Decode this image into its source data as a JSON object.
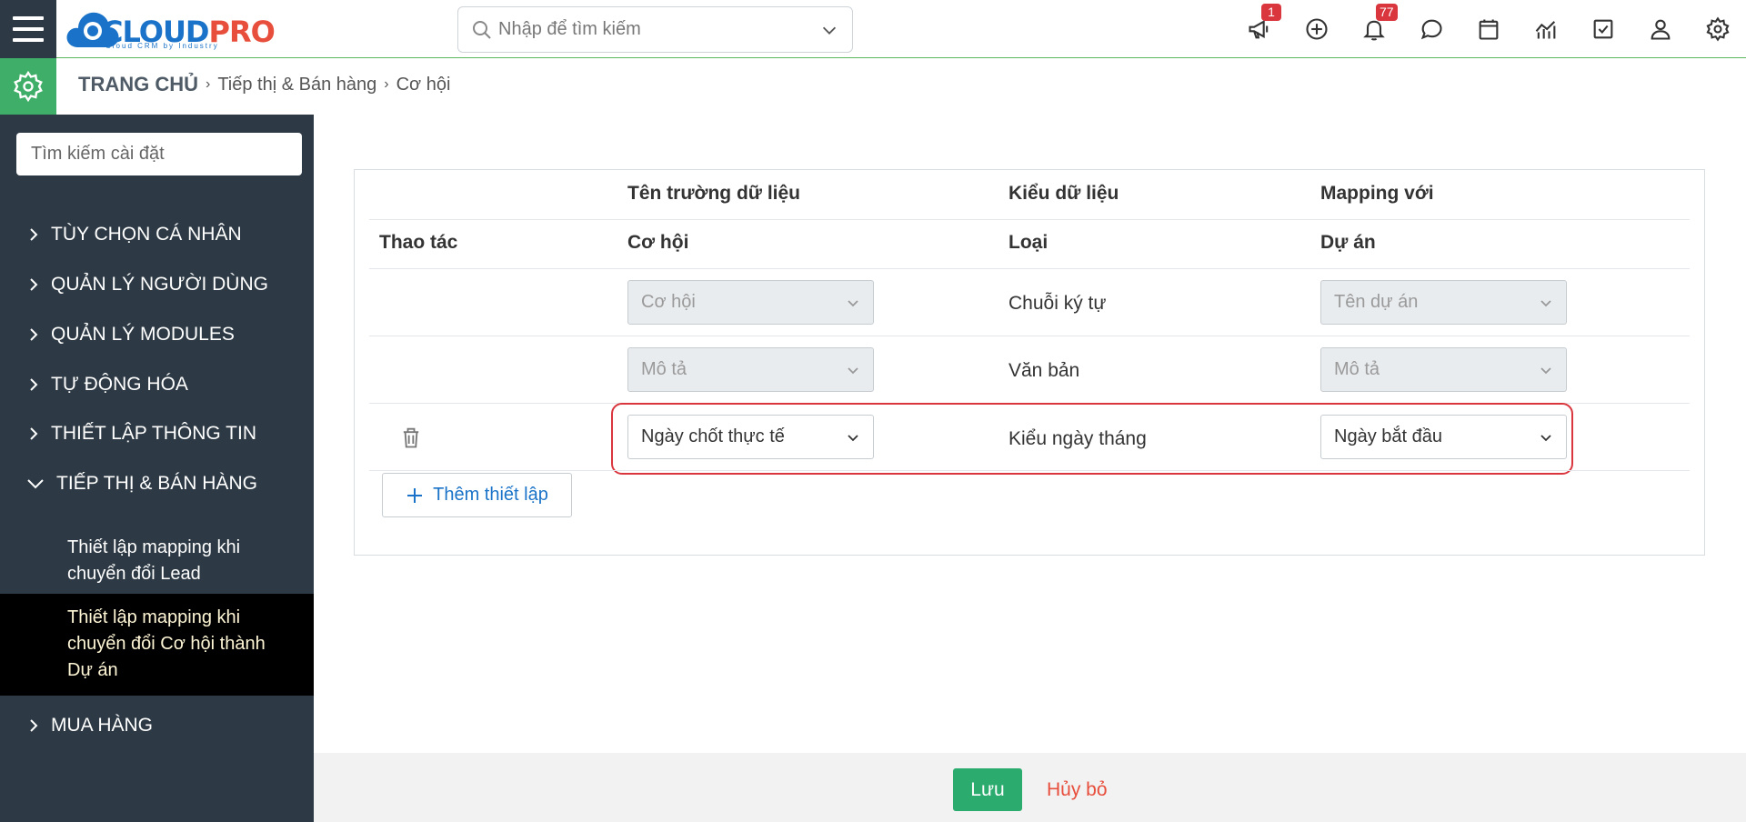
{
  "topbar": {
    "logo_main": "CLOUD",
    "logo_accent": "PRO",
    "logo_tagline": "Cloud CRM by Industry",
    "search_placeholder": "Nhập để tìm kiếm",
    "announcement_badge": "1",
    "notification_badge": "77",
    "icons": [
      "megaphone-icon",
      "plus-circle-icon",
      "bell-icon",
      "chat-icon",
      "calendar-icon",
      "chart-icon",
      "checkbox-icon",
      "user-icon",
      "gear-icon"
    ],
    "accent_color": "#3fae68"
  },
  "breadcrumb": {
    "home": "TRANG CHỦ",
    "section": "Tiếp thị & Bán hàng",
    "page": "Cơ hội"
  },
  "sidebar": {
    "search_placeholder": "Tìm kiếm cài đặt",
    "items": [
      {
        "label": "TÙY CHỌN CÁ NHÂN"
      },
      {
        "label": "QUẢN LÝ NGƯỜI DÙNG"
      },
      {
        "label": "QUẢN LÝ MODULES"
      },
      {
        "label": "TỰ ĐỘNG HÓA"
      },
      {
        "label": "THIẾT LẬP THÔNG TIN"
      },
      {
        "label": "TIẾP THỊ & BÁN HÀNG"
      },
      {
        "label": "MUA HÀNG"
      }
    ],
    "sub_items": [
      {
        "line1": "Thiết lập mapping khi",
        "line2": "chuyển đổi Lead"
      },
      {
        "line1": "Thiết lập mapping khi",
        "line2": "chuyển đổi Cơ hội thành",
        "line3": "Dự án"
      }
    ]
  },
  "mapping_table": {
    "headers_top": {
      "field_name": "Tên trường dữ liệu",
      "data_type": "Kiểu dữ liệu",
      "mapping": "Mapping với"
    },
    "headers_sub": {
      "action": "Thao tác",
      "source_module": "Cơ hội",
      "type": "Loại",
      "target_module": "Dự án"
    },
    "rows": [
      {
        "source": "Cơ hội",
        "type": "Chuỗi ký tự",
        "target": "Tên dự án"
      },
      {
        "source": "Mô tả",
        "type": "Văn bản",
        "target": "Mô tả"
      },
      {
        "source": "Ngày chốt thực tế",
        "type": "Kiểu ngày tháng",
        "target": "Ngày bắt đầu"
      }
    ],
    "add_label": "Thêm thiết lập"
  },
  "footer": {
    "save_label": "Lưu",
    "cancel_label": "Hủy bỏ"
  }
}
